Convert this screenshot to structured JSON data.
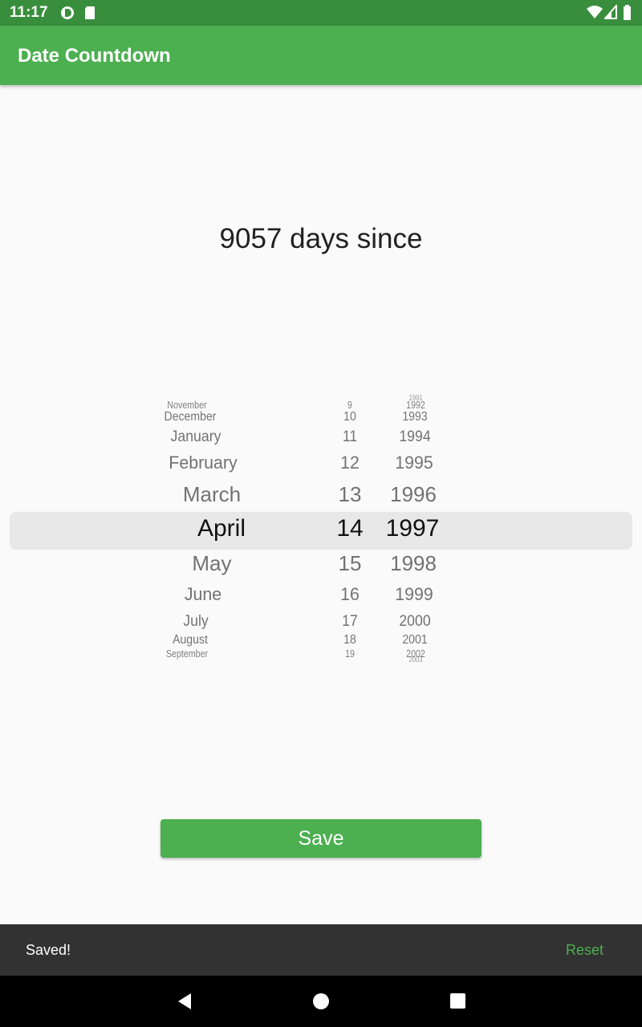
{
  "status": {
    "time": "11:17"
  },
  "app": {
    "title": "Date Countdown"
  },
  "headline": "9057 days since",
  "picker": {
    "months": [
      "November",
      "December",
      "January",
      "February",
      "March",
      "April",
      "May",
      "June",
      "July",
      "August",
      "September"
    ],
    "days": [
      "9",
      "10",
      "11",
      "12",
      "13",
      "14",
      "15",
      "16",
      "17",
      "18",
      "19"
    ],
    "years": [
      "1991",
      "1992",
      "1993",
      "1994",
      "1995",
      "1996",
      "1997",
      "1998",
      "1999",
      "2000",
      "2001",
      "2002",
      "2003"
    ],
    "selected": {
      "month": "April",
      "day": "14",
      "year": "1997"
    }
  },
  "save_label": "Save",
  "snackbar": {
    "message": "Saved!",
    "action": "Reset"
  },
  "colors": {
    "primary": "#4caf50",
    "primary_dark": "#388e3c",
    "snackbar": "#323232"
  },
  "icons": [
    "wifi-icon",
    "signal-icon",
    "battery-icon",
    "back-icon",
    "home-icon",
    "recents-icon"
  ]
}
